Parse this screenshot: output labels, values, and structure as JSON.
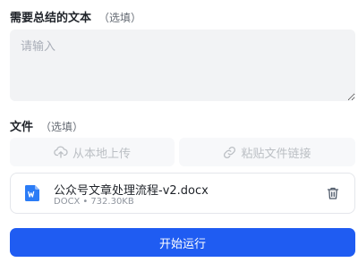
{
  "text_section": {
    "label": "需要总结的文本",
    "optional_tag": "（选填）",
    "placeholder": "请输入",
    "value": ""
  },
  "file_section": {
    "label": "文件",
    "optional_tag": "（选填）",
    "upload_local_label": "从本地上传",
    "paste_link_label": "粘贴文件链接"
  },
  "file": {
    "name": "公众号文章处理流程-v2.docx",
    "type": "DOCX",
    "separator": "•",
    "size": "732.30KB",
    "icon": "word-doc-icon",
    "icon_color": "#2b7cf6"
  },
  "run_button": {
    "label": "开始运行",
    "color": "#1f5cf2"
  }
}
